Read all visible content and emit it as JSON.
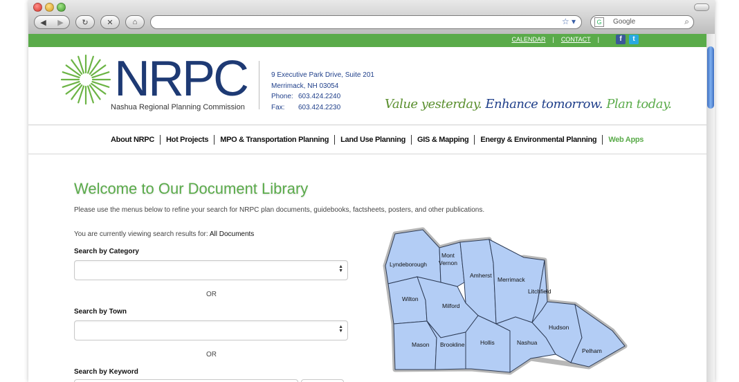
{
  "browser": {
    "search_placeholder": "Google",
    "search_engine_icon": "G"
  },
  "topbar": {
    "links": [
      "CALENDAR",
      "CONTACT"
    ],
    "separator": "|",
    "facebook": "f",
    "twitter": "t",
    "colors": {
      "green": "#5aab4a"
    }
  },
  "header": {
    "logo_word": "NRPC",
    "logo_subtitle": "Nashua Regional Planning Commission",
    "address_line1": "9 Executive Park Drive, Suite 201",
    "address_line2": "Merrimack, NH 03054",
    "phone_label": "Phone:",
    "phone": "603.424.2240",
    "fax_label": "Fax:",
    "fax": "603.424.2230",
    "tagline_1": "Value yesterday.",
    "tagline_2": "Enhance tomorrow.",
    "tagline_3": "Plan today."
  },
  "nav": {
    "items": [
      "About NRPC",
      "Hot Projects",
      "MPO & Transportation Planning",
      "Land Use Planning",
      "GIS & Mapping",
      "Energy & Environmental Planning",
      "Web Apps"
    ],
    "active_index": 6
  },
  "main": {
    "title": "Welcome to Our Document Library",
    "intro": "Please use the menus below to refine your search for NRPC plan documents, guidebooks, factsheets, posters, and other publications.",
    "viewing_prefix": "You are currently viewing search results for:",
    "viewing_value": "All Documents",
    "category_label": "Search by Category",
    "or_label": "OR",
    "town_label": "Search by Town",
    "keyword_label": "Search by Keyword"
  },
  "map": {
    "towns": [
      "Lyndeborough",
      "Mont",
      "Vernon",
      "Amherst",
      "Merrimack",
      "Litchfield",
      "Wilton",
      "Milford",
      "Hudson",
      "Mason",
      "Brookline",
      "Hollis",
      "Nashua",
      "Pelham"
    ],
    "colors": {
      "fill": "#b3cdf5",
      "stroke": "#2d3b55"
    }
  }
}
